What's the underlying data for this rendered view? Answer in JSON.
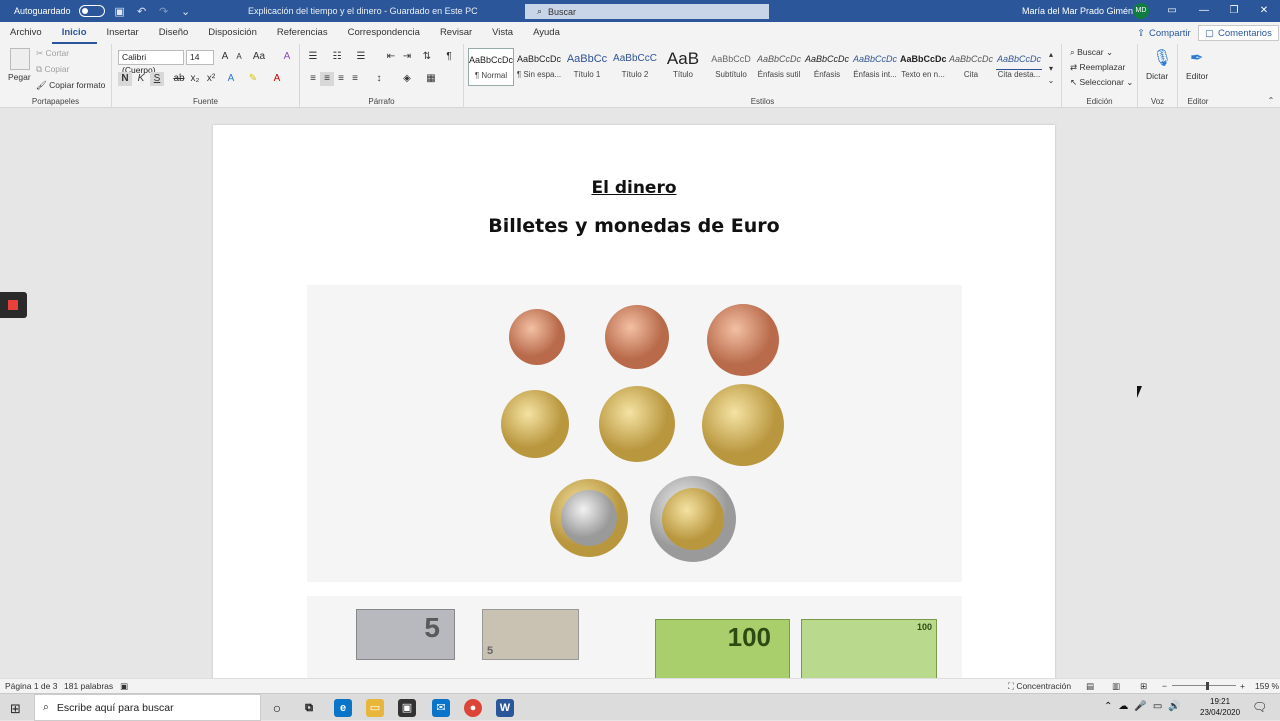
{
  "titlebar": {
    "autosave_label": "Autoguardado",
    "doc_title": "Explicación del tiempo y el dinero - Guardado en Este PC",
    "search_placeholder": "Buscar",
    "user_name": "María del Mar Prado Giménez",
    "user_initials": "MD"
  },
  "tabs": [
    "Archivo",
    "Inicio",
    "Insertar",
    "Diseño",
    "Disposición",
    "Referencias",
    "Correspondencia",
    "Revisar",
    "Vista",
    "Ayuda"
  ],
  "active_tab": "Inicio",
  "share_label": "Compartir",
  "comments_label": "Comentarios",
  "ribbon": {
    "clipboard": {
      "paste": "Pegar",
      "cut": "Cortar",
      "copy": "Copiar",
      "format_painter": "Copiar formato",
      "label": "Portapapeles"
    },
    "font": {
      "family": "Calibri (Cuerpo)",
      "size": "14",
      "label": "Fuente",
      "bold": "N",
      "italic": "K",
      "underline": "S"
    },
    "paragraph": {
      "label": "Párrafo"
    },
    "styles": {
      "label": "Estilos",
      "items": [
        {
          "preview": "AaBbCcDc",
          "name": "¶ Normal"
        },
        {
          "preview": "AaBbCcDc",
          "name": "¶ Sin espa..."
        },
        {
          "preview": "AaBbCc",
          "name": "Título 1"
        },
        {
          "preview": "AaBbCcC",
          "name": "Título 2"
        },
        {
          "preview": "AaB",
          "name": "Título"
        },
        {
          "preview": "AaBbCcD",
          "name": "Subtítulo"
        },
        {
          "preview": "AaBbCcDc",
          "name": "Énfasis sutil"
        },
        {
          "preview": "AaBbCcDc",
          "name": "Énfasis"
        },
        {
          "preview": "AaBbCcDc",
          "name": "Énfasis int..."
        },
        {
          "preview": "AaBbCcDc",
          "name": "Texto en n..."
        },
        {
          "preview": "AaBbCcDc",
          "name": "Cita"
        },
        {
          "preview": "AaBbCcDc",
          "name": "Cita desta..."
        }
      ]
    },
    "editing": {
      "find": "Buscar",
      "replace": "Reemplazar",
      "select": "Seleccionar",
      "label": "Edición"
    },
    "voice": {
      "dictate": "Dictar",
      "label": "Voz"
    },
    "editor": {
      "editor": "Editor",
      "label": "Editor"
    }
  },
  "document": {
    "heading": "El dinero",
    "subheading": "Billetes y monedas de Euro",
    "banknotes": [
      "5",
      "5",
      "100",
      "100"
    ]
  },
  "status": {
    "page": "Página 1 de 3",
    "words": "181 palabras",
    "focus": "Concentración",
    "zoom": "159 %"
  },
  "taskbar": {
    "search_placeholder": "Escribe aquí para buscar",
    "time": "19:21",
    "date": "23/04/2020"
  }
}
